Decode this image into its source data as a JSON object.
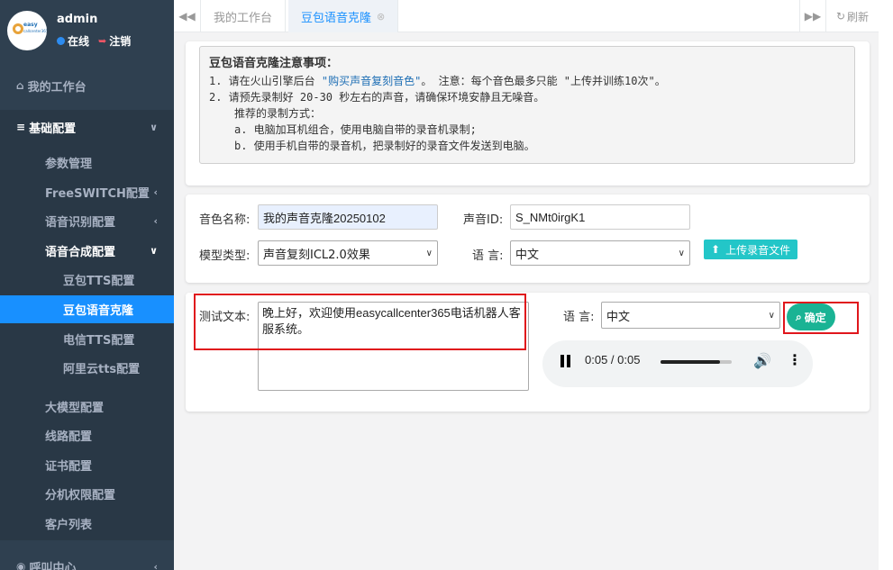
{
  "profile": {
    "username": "admin",
    "online": "在线",
    "logout": "注销",
    "logo_text": "easy",
    "logo_sub": "callcenter365"
  },
  "sidebar": {
    "workbench": "我的工作台",
    "basic_config": "基础配置",
    "items": [
      "参数管理",
      "FreeSWITCH配置",
      "语音识别配置",
      "语音合成配置"
    ],
    "tts_items": [
      "豆包TTS配置",
      "豆包语音克隆",
      "电信TTS配置",
      "阿里云tts配置"
    ],
    "more_items": [
      "大模型配置",
      "线路配置",
      "证书配置",
      "分机权限配置",
      "客户列表"
    ],
    "call_center": "呼叫中心"
  },
  "tabs": {
    "workbench": "我的工作台",
    "active": "豆包语音克隆",
    "refresh": "刷新"
  },
  "notice": {
    "title": "豆包语音克隆注意事项：",
    "line1_a": "1. 请在火山引擎后台 ",
    "line1_link": "\"购买声音复刻音色\"",
    "line1_b": "。  注意：每个音色最多只能 \"上传并训练10次\"。",
    "line2": "2. 请预先录制好 20-30 秒左右的声音，请确保环境安静且无噪音。",
    "line3": "推荐的录制方式：",
    "line4": "a. 电脑加耳机组合，使用电脑自带的录音机录制;",
    "line5": "b. 使用手机自带的录音机，把录制好的录音文件发送到电脑。"
  },
  "form": {
    "voice_name_label": "音色名称:",
    "voice_name": "我的声音克隆20250102",
    "voice_id_label": "声音ID:",
    "voice_id": "S_NMt0irgK1",
    "model_label": "模型类型:",
    "model": "声音复刻ICL2.0效果",
    "lang_label": "语 言:",
    "lang": "中文",
    "upload": "上传录音文件"
  },
  "test": {
    "label": "测试文本:",
    "text": "晚上好，欢迎使用easycallcenter365电话机器人客服系统。",
    "lang_label": "语 言:",
    "lang": "中文",
    "confirm": "确定",
    "audio_time": "0:05 / 0:05",
    "audio_progress": 0.84
  },
  "colors": {
    "sidebar": "#2f4050",
    "active": "#1890ff",
    "primary": "#1ab394",
    "info": "#23c6c8",
    "highlight": "#e0161c"
  }
}
